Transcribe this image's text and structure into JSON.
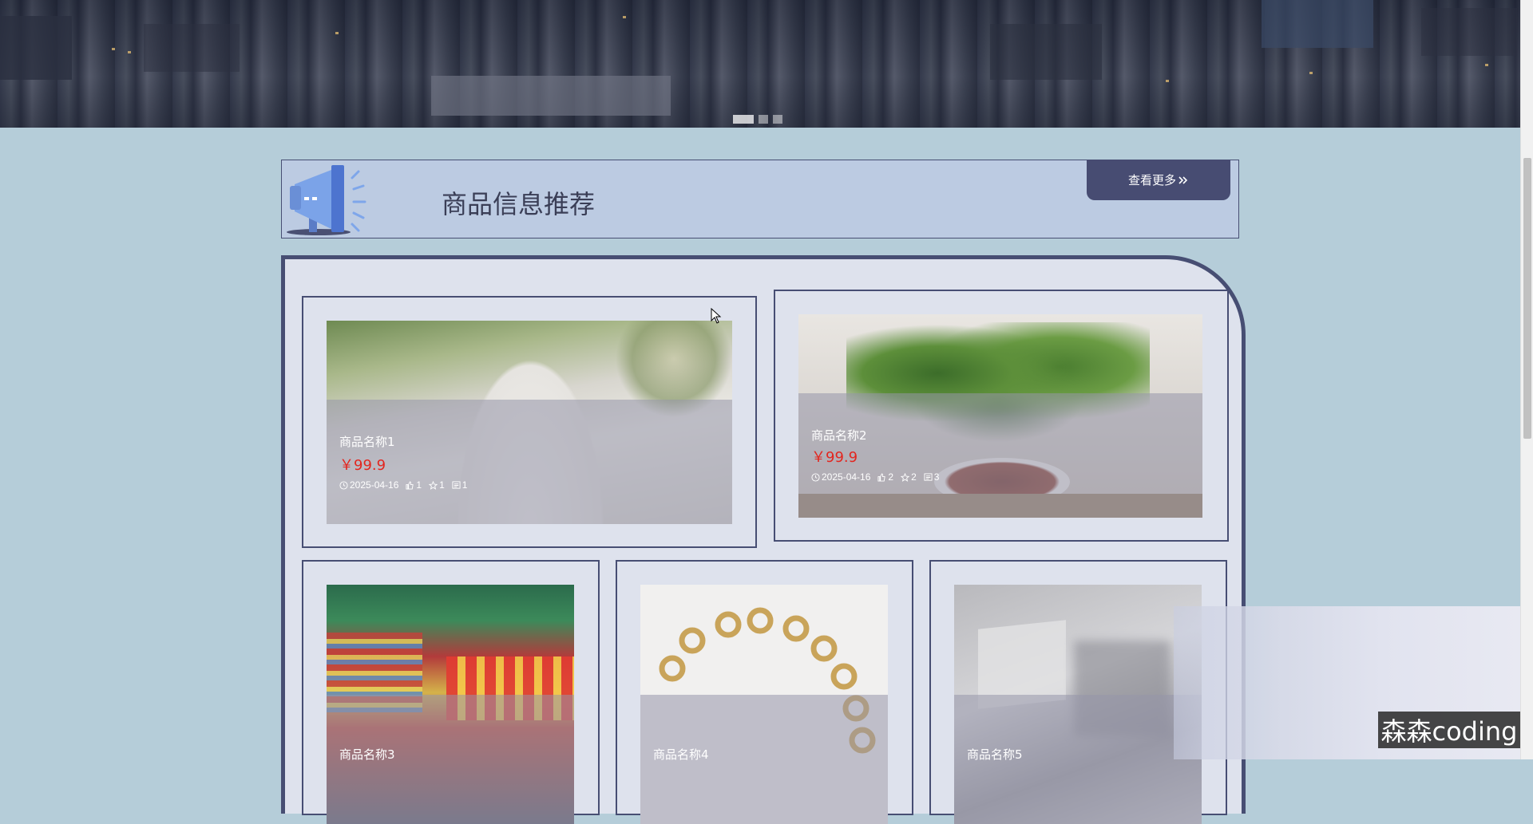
{
  "banner": {
    "slides": 3,
    "active_slide": 1
  },
  "section": {
    "title": "商品信息推荐",
    "more_label": "查看更多",
    "more_icon": "double-chevron-right-icon"
  },
  "products": [
    {
      "name": "商品名称1",
      "price": "￥99.9",
      "date": "2025-04-16",
      "likes": "1",
      "favorites": "1",
      "comments": "1",
      "image": "flour-photo"
    },
    {
      "name": "商品名称2",
      "price": "￥99.9",
      "date": "2025-04-16",
      "likes": "2",
      "favorites": "2",
      "comments": "3",
      "image": "plant-photo"
    },
    {
      "name": "商品名称3",
      "image": "supermarket-photo"
    },
    {
      "name": "商品名称4",
      "image": "bracelet-photo"
    },
    {
      "name": "商品名称5",
      "image": "shopping-bags-photo"
    }
  ],
  "watermark": "森森coding",
  "colors": {
    "page_bg": "#b5cdd9",
    "accent": "#474e73",
    "price": "#e3261f",
    "panel_bg": "#dee2ed",
    "header_bg": "#bccbe2"
  }
}
